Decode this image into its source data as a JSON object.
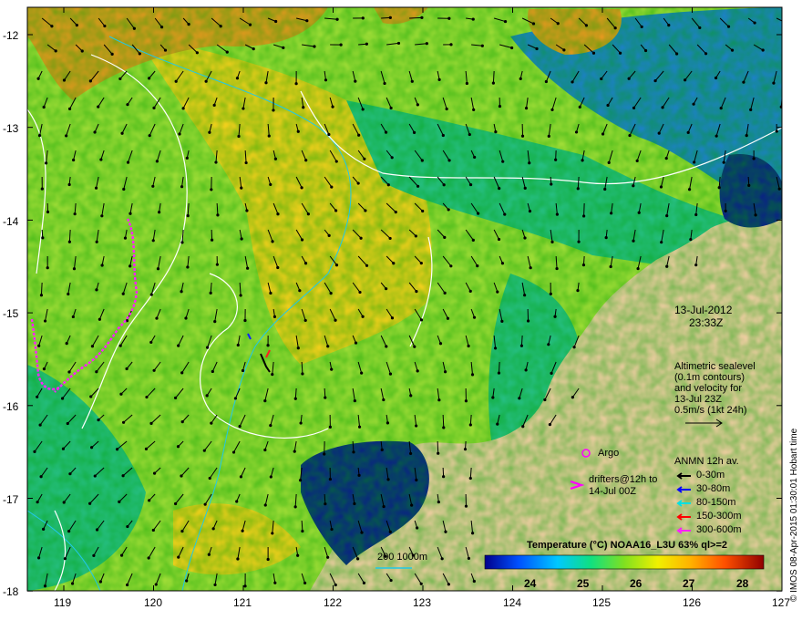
{
  "map": {
    "lon_range": [
      118.6,
      127
    ],
    "lat_range": [
      -18,
      -11.8
    ],
    "x_ticks": [
      "119",
      "120",
      "121",
      "122",
      "123",
      "124",
      "125",
      "126",
      "127"
    ],
    "y_ticks": [
      "-12",
      "-13",
      "-14",
      "-15",
      "-16",
      "-17",
      "-18"
    ],
    "colors": {
      "ocean_warm": "#a8e03a",
      "ocean_hot": "#ffd21e",
      "ocean_cool": "#28c08a",
      "ocean_cold": "#1e7fd0",
      "land": "#f8cfa8",
      "cloud": "#0a1a8c",
      "orange": "#f09820",
      "contour": "#ffffff",
      "isobath": "#20c8e8",
      "argo_track": "#ff20ff"
    }
  },
  "annotations": {
    "date": "13-Jul-2012",
    "time": "23:33Z",
    "sealevel_lines": [
      "Altimetric sealevel",
      "(0.1m contours)",
      "and velocity for",
      "13-Jul 23Z",
      "0.5m/s (1kt 24h)"
    ],
    "argo_label": "Argo",
    "drifters_lines": [
      "drifters@12h to",
      "14-Jul 00Z"
    ],
    "anmn_title": "ANMN 12h av.",
    "anmn_items": [
      {
        "label": "0-30m",
        "color": "#000000"
      },
      {
        "label": "30-80m",
        "color": "#0000ff"
      },
      {
        "label": "80-150m",
        "color": "#00e0e0"
      },
      {
        "label": "150-300m",
        "color": "#ff0000"
      },
      {
        "label": "300-600m",
        "color": "#ff20ff"
      }
    ],
    "isobath_label": "200  1000m"
  },
  "colorbar": {
    "title": "Temperature (°C) NOAA16_L3U 63% ql>=2",
    "ticks": [
      "24",
      "25",
      "26",
      "27",
      "28"
    ],
    "range": [
      23.1,
      28.4
    ]
  },
  "credit": "© IMOS 08-Apr-2015 01:30:01 Hobart time"
}
